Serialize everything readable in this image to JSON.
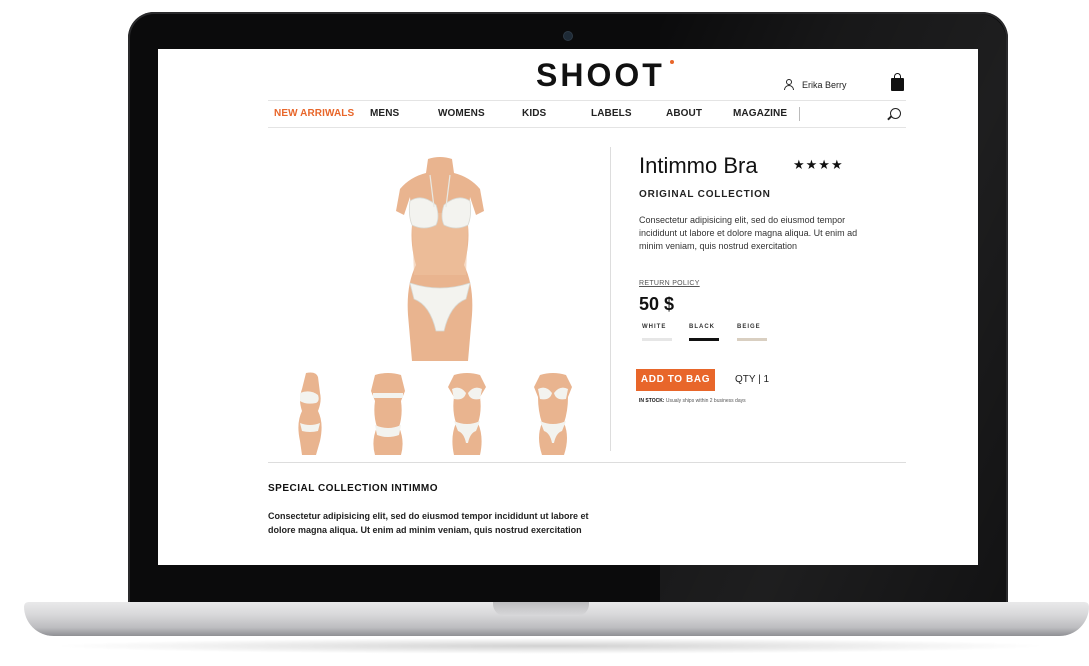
{
  "site": {
    "logo": "SHOOT",
    "user_name": "Erika Berry"
  },
  "nav": {
    "items": [
      "NEW ARRIWALS",
      "MENS",
      "WOMENS",
      "KIDS",
      "LABELS",
      "ABOUT",
      "MAGAZINE"
    ],
    "active_index": 0
  },
  "product": {
    "title": "Intimmo Bra",
    "rating_stars": "★★★★",
    "collection": "ORIGINAL COLLECTION",
    "description": "Consectetur adipisicing elit, sed do eiusmod tempor incididunt ut labore et dolore magna aliqua. Ut enim ad minim veniam, quis nostrud exercitation",
    "return_policy": "RETURN POLICY",
    "price": "50 $",
    "colors": [
      {
        "label": "WHITE",
        "swatch": "#e6e6e6"
      },
      {
        "label": "BLACK",
        "swatch": "#111111"
      },
      {
        "label": "BEIGE",
        "swatch": "#d9cfc1"
      }
    ],
    "selected_color": "BLACK",
    "add_to_bag": "ADD TO BAG",
    "qty": "QTY | 1",
    "stock_label": "IN STOCK:",
    "stock_text": "Usualy ships within 2 business days"
  },
  "special": {
    "title": "SPECIAL COLLECTION INTIMMO",
    "text": "Consectetur adipisicing elit, sed do eiusmod tempor incididunt ut labore et dolore magna aliqua. Ut enim ad minim veniam, quis nostrud exercitation"
  },
  "colors": {
    "accent": "#e8662a",
    "text": "#111111",
    "skin": "#e9b48f",
    "lingerie": "#f2f2ee"
  }
}
